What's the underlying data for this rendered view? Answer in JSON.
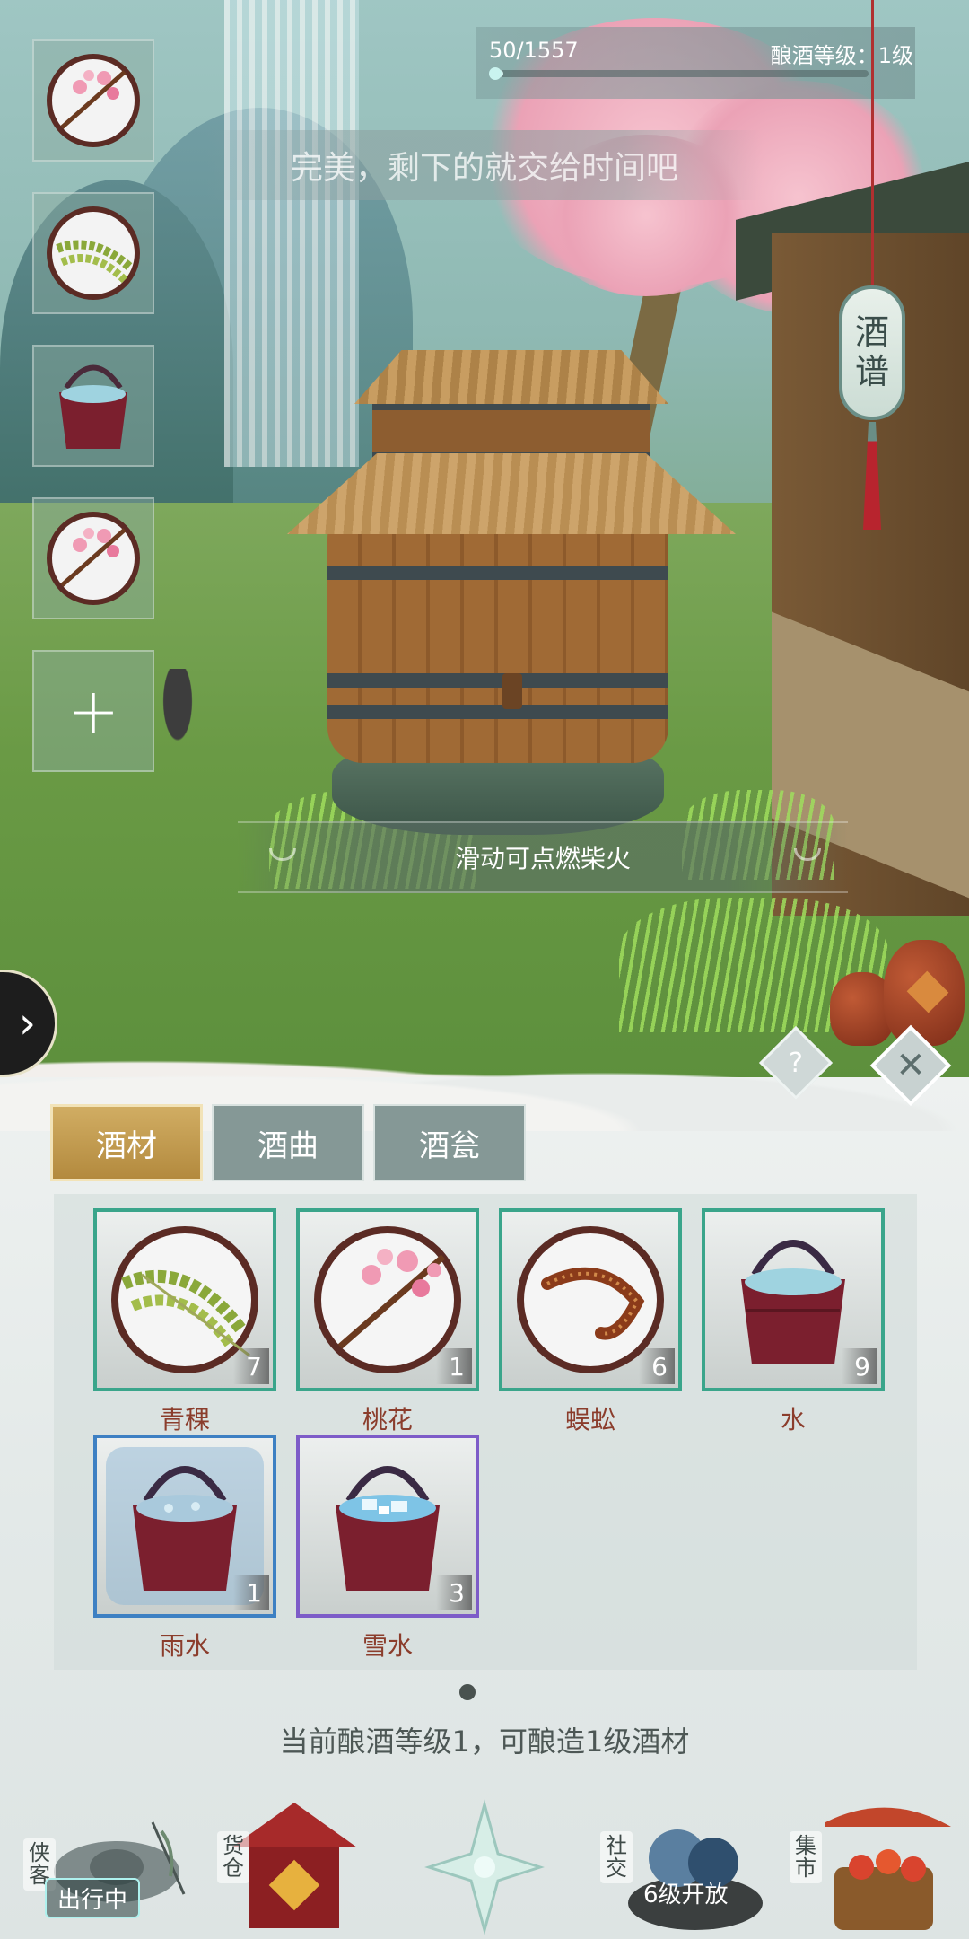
{
  "hud": {
    "progress_text": "50/1557",
    "progress_fraction": 0.032,
    "level_text": "酿酒等级：1级",
    "message": "完美，剩下的就交给时间吧",
    "fire_hint": "滑动可点燃柴火",
    "recipe_button": [
      "酒",
      "谱"
    ]
  },
  "added_slots": [
    {
      "icon": "peach-blossom-icon"
    },
    {
      "icon": "barley-icon"
    },
    {
      "icon": "water-bucket-icon"
    },
    {
      "icon": "peach-blossom-icon"
    }
  ],
  "add_slot_icon": "plus-icon",
  "tabs": [
    {
      "label": "酒材",
      "active": true
    },
    {
      "label": "酒曲",
      "active": false
    },
    {
      "label": "酒瓮",
      "active": false
    }
  ],
  "inventory": [
    {
      "name": "青稞",
      "count": "7",
      "icon": "barley-icon",
      "rarity": "common"
    },
    {
      "name": "桃花",
      "count": "1",
      "icon": "peach-blossom-icon",
      "rarity": "common"
    },
    {
      "name": "蜈蚣",
      "count": "6",
      "icon": "centipede-icon",
      "rarity": "common"
    },
    {
      "name": "水",
      "count": "9",
      "icon": "water-bucket-icon",
      "rarity": "common"
    },
    {
      "name": "雨水",
      "count": "1",
      "icon": "rain-water-bucket-icon",
      "rarity": "rare"
    },
    {
      "name": "雪水",
      "count": "3",
      "icon": "snow-water-bucket-icon",
      "rarity": "epic"
    }
  ],
  "level_note": "当前酿酒等级1，可酿造1级酒材",
  "help_label": "?",
  "close_label": "✕",
  "side_arrow": "›",
  "nav": [
    {
      "label": "侠客",
      "badge": "出行中"
    },
    {
      "label": "货仓",
      "badge": ""
    },
    {
      "label": "",
      "badge": ""
    },
    {
      "label": "社交",
      "badge": "6级开放"
    },
    {
      "label": "集市",
      "badge": ""
    }
  ],
  "colors": {
    "common_border": "#3aa58b",
    "rare_border": "#3d80c3",
    "epic_border": "#7d5cc8",
    "item_name": "#8b3d2c",
    "active_tab": "#c39b4f"
  }
}
